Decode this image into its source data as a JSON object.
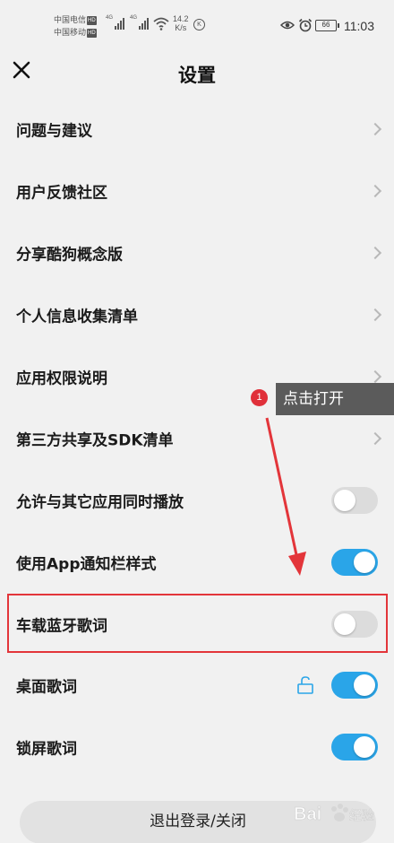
{
  "status_bar": {
    "carrier1": "中国电信",
    "carrier2": "中国移动",
    "hd_badge": "HD",
    "net_type": "4G",
    "speed_value": "14.2",
    "speed_unit": "K/s",
    "k_icon": "K",
    "battery": "66",
    "time": "11:03",
    "icons": [
      "signal-icon",
      "wifi-icon",
      "eye-icon",
      "alarm-icon",
      "battery-icon"
    ]
  },
  "header": {
    "title": "设置",
    "close_icon": "close-icon"
  },
  "settings": [
    {
      "label": "问题与建议",
      "control": "chevron"
    },
    {
      "label": "用户反馈社区",
      "control": "chevron"
    },
    {
      "label": "分享酷狗概念版",
      "control": "chevron"
    },
    {
      "label": "个人信息收集清单",
      "control": "chevron"
    },
    {
      "label": "应用权限说明",
      "control": "chevron"
    },
    {
      "label": "第三方共享及SDK清单",
      "control": "chevron"
    },
    {
      "label": "允许与其它应用同时播放",
      "control": "toggle",
      "on": false
    },
    {
      "label": "使用App通知栏样式",
      "control": "toggle",
      "on": true
    },
    {
      "label": "车载蓝牙歌词",
      "control": "toggle",
      "on": false
    },
    {
      "label": "桌面歌词",
      "control": "toggle",
      "on": true,
      "extra_icon": "unlock-icon"
    },
    {
      "label": "锁屏歌词",
      "control": "toggle",
      "on": true
    }
  ],
  "logout_label": "退出登录/关闭",
  "annotation": {
    "step_number": "1",
    "tooltip": "点击打开"
  },
  "watermark": {
    "brand": "Bai",
    "brand_suffix": "经验"
  },
  "colors": {
    "toggle_on": "#2aa5e8",
    "toggle_off": "#dcdcdc",
    "annotation_red": "#e3353a",
    "tooltip_bg": "#5b5b5b"
  }
}
